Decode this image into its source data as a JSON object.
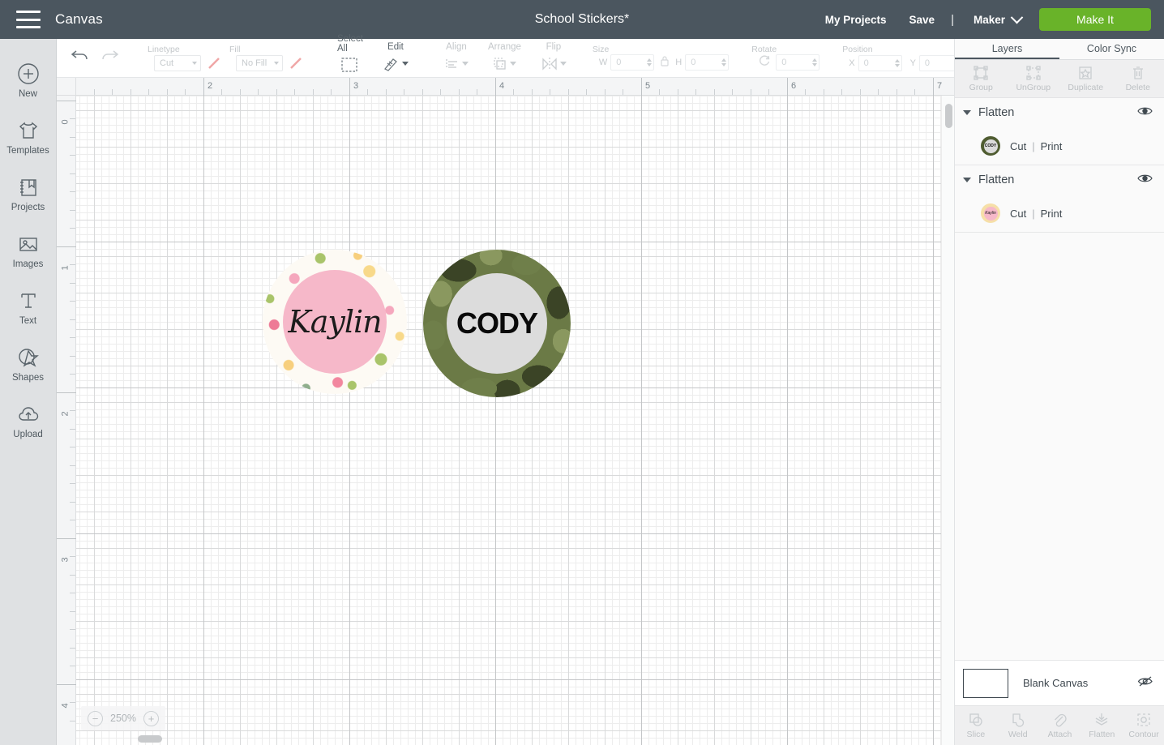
{
  "header": {
    "menu_icon": "hamburger-menu-icon",
    "canvas_label": "Canvas",
    "document_title": "School Stickers*",
    "my_projects": "My Projects",
    "save": "Save",
    "divider": "|",
    "machine": "Maker",
    "make_it": "Make It",
    "bg_color": "#4b565f",
    "make_it_color": "#69b329"
  },
  "sidebar": {
    "items": [
      {
        "label": "New",
        "icon": "plus-circle-icon"
      },
      {
        "label": "Templates",
        "icon": "tshirt-icon"
      },
      {
        "label": "Projects",
        "icon": "book-bookmark-icon"
      },
      {
        "label": "Images",
        "icon": "photo-icon"
      },
      {
        "label": "Text",
        "icon": "text-t-icon"
      },
      {
        "label": "Shapes",
        "icon": "star-shape-icon"
      },
      {
        "label": "Upload",
        "icon": "cloud-upload-icon"
      }
    ]
  },
  "toolbar": {
    "undo": "undo-icon",
    "redo": "redo-icon",
    "linetype": {
      "title": "Linetype",
      "value": "Cut",
      "swatch": "line-swatch"
    },
    "fill": {
      "title": "Fill",
      "value": "No Fill",
      "swatch": "line-swatch"
    },
    "select_all": "Select All",
    "edit": "Edit",
    "align": "Align",
    "arrange": "Arrange",
    "flip": "Flip",
    "size": {
      "title": "Size",
      "w_label": "W",
      "w_value": "0",
      "h_label": "H",
      "h_value": "0",
      "lock": "lock-icon"
    },
    "rotate": {
      "title": "Rotate",
      "value": "0"
    },
    "position": {
      "title": "Position",
      "x_label": "X",
      "x_value": "0",
      "y_label": "Y",
      "y_value": "0"
    }
  },
  "canvas": {
    "ruler_h_labels": [
      "2",
      "3",
      "4",
      "5",
      "6",
      "7"
    ],
    "ruler_v_labels": [
      "0",
      "1",
      "2",
      "3",
      "4"
    ],
    "zoom_level": "250%",
    "zoom_out": "−",
    "zoom_in": "+",
    "stickers": [
      {
        "name": "Kaylin",
        "border_style": "floral",
        "center_color": "#f6b8c9"
      },
      {
        "name": "CODY",
        "border_style": "camo",
        "center_color": "#dcdcdc"
      }
    ]
  },
  "right_panel": {
    "tabs": [
      {
        "label": "Layers",
        "active": true
      },
      {
        "label": "Color Sync",
        "active": false
      }
    ],
    "actions": [
      {
        "label": "Group",
        "icon": "group-icon"
      },
      {
        "label": "UnGroup",
        "icon": "ungroup-icon"
      },
      {
        "label": "Duplicate",
        "icon": "duplicate-icon"
      },
      {
        "label": "Delete",
        "icon": "trash-icon"
      }
    ],
    "layers": [
      {
        "title": "Flatten",
        "visibility_icon": "eye-icon",
        "rows": [
          {
            "thumb": "cody",
            "thumb_text": "CODY",
            "op_primary": "Cut",
            "op_divider": "|",
            "op_secondary": "Print"
          }
        ]
      },
      {
        "title": "Flatten",
        "visibility_icon": "eye-icon",
        "rows": [
          {
            "thumb": "kaylin",
            "thumb_text": "Kaylin",
            "op_primary": "Cut",
            "op_divider": "|",
            "op_secondary": "Print"
          }
        ]
      }
    ],
    "blank_canvas": {
      "label": "Blank Canvas",
      "visibility_icon": "eye-off-icon"
    },
    "tools": [
      {
        "label": "Slice",
        "icon": "slice-icon"
      },
      {
        "label": "Weld",
        "icon": "weld-icon"
      },
      {
        "label": "Attach",
        "icon": "paperclip-icon"
      },
      {
        "label": "Flatten",
        "icon": "flatten-icon"
      },
      {
        "label": "Contour",
        "icon": "contour-icon"
      }
    ]
  }
}
